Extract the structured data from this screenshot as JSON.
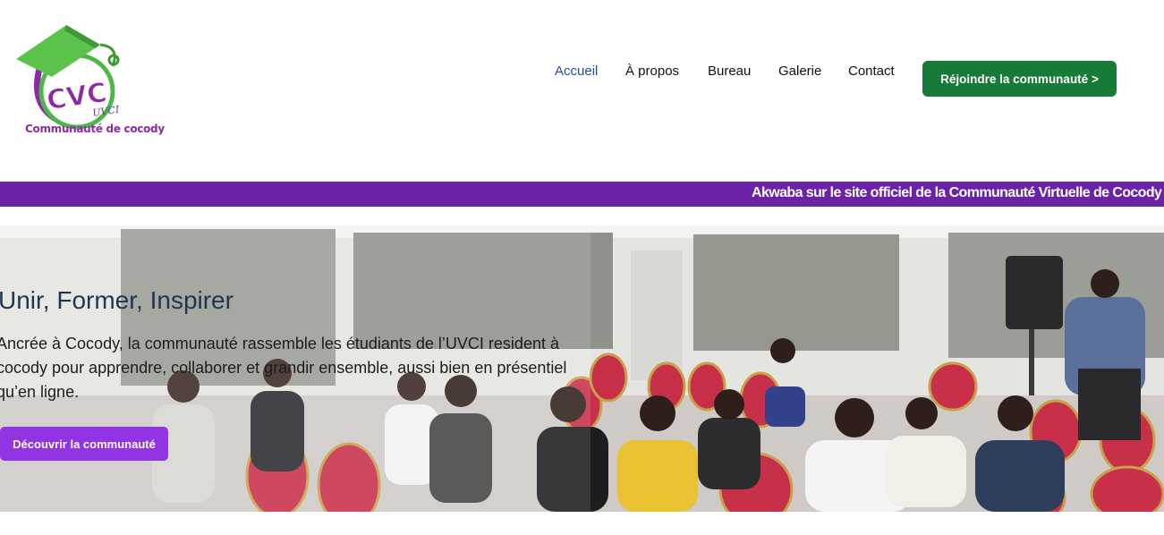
{
  "logo": {
    "initials": "CVC",
    "sub_label": "UVCI",
    "caption": "Communauté de cocody"
  },
  "nav": {
    "items": [
      "Accueil",
      "À propos",
      "Bureau",
      "Galerie",
      "Contact"
    ],
    "active": "Accueil",
    "join_label": "Réjoindre la communauté >"
  },
  "banner": {
    "text": "Akwaba sur le site officiel de la Communauté Virtuelle de Cocody"
  },
  "hero": {
    "title": "Unir, Former, Inspirer",
    "description": "Ancrée à Cocody, la communauté rassemble les étudiants de l’UVCI resident à cocody pour apprendre, collaborer et grandir ensemble, aussi bien en présentiel qu’en ligne.",
    "cta_label": "Découvrir la communauté"
  },
  "colors": {
    "brand_green": "#177a36",
    "band_purple": "#6a22a7",
    "cta_purple": "#9234e4",
    "nav_active": "#1f4e9c"
  }
}
